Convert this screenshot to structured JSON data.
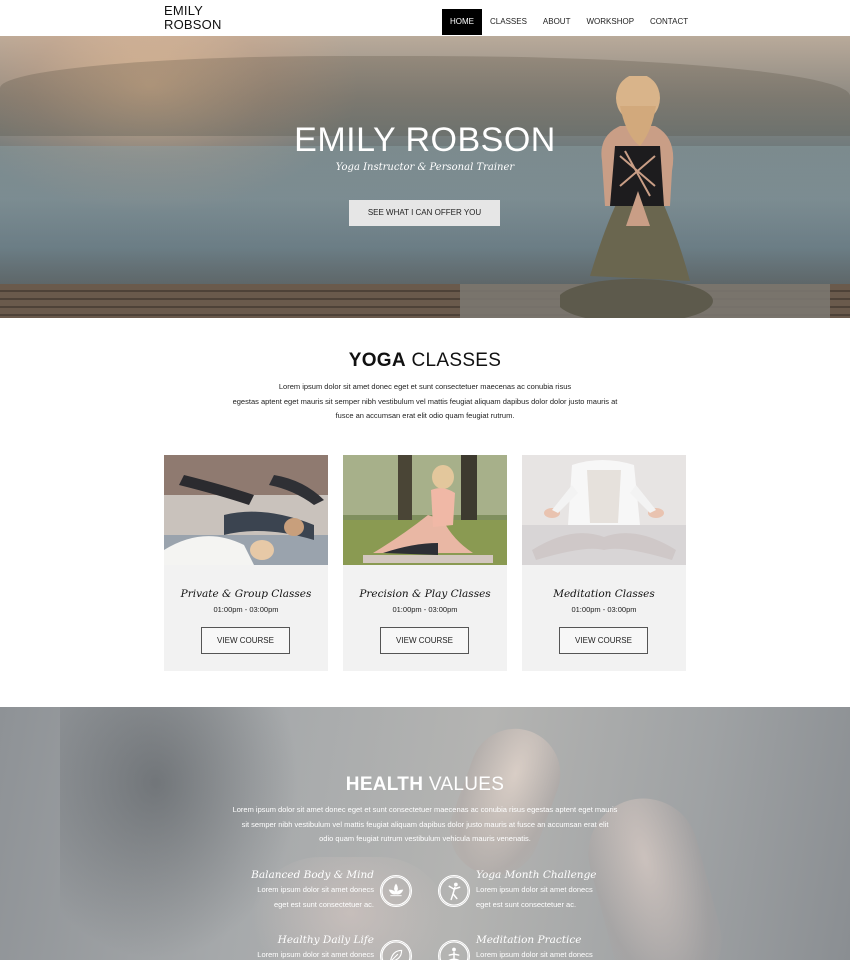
{
  "header": {
    "logo_line1": "EMILY",
    "logo_line2": "ROBSON",
    "nav": [
      "HOME",
      "CLASSES",
      "ABOUT",
      "WORKSHOP",
      "CONTACT"
    ]
  },
  "hero": {
    "title": "EMILY ROBSON",
    "subtitle": "Yoga Instructor & Personal Trainer",
    "cta": "SEE WHAT I CAN OFFER YOU"
  },
  "classes": {
    "title_bold": "YOGA",
    "title_rest": " CLASSES",
    "lorem_line1": "Lorem ipsum dolor sit amet donec eget et sunt consectetuer maecenas ac conubia risus",
    "lorem_line2": "egestas aptent eget mauris sit semper nibh vestibulum vel mattis feugiat aliquam dapibus dolor dolor justo mauris at",
    "lorem_line3": "fusce an accumsan erat elit odio quam feugiat rutrum.",
    "cards": [
      {
        "title": "Private & Group Classes",
        "time": "01:00pm - 03:00pm",
        "button": "VIEW COURSE"
      },
      {
        "title": "Precision & Play Classes",
        "time": "01:00pm - 03:00pm",
        "button": "VIEW COURSE"
      },
      {
        "title": "Meditation Classes",
        "time": "01:00pm - 03:00pm",
        "button": "VIEW COURSE"
      }
    ]
  },
  "health": {
    "title_bold": "HEALTH",
    "title_rest": " VALUES",
    "lorem_line1": "Lorem ipsum dolor sit amet donec eget et sunt consectetuer maecenas ac conubia risus egestas aptent eget mauris",
    "lorem_line2": "sit semper nibh vestibulum vel mattis feugiat aliquam dapibus dolor justo mauris at fusce an accumsan erat elit",
    "lorem_line3": "odio quam feugiat rutrum vestibulum vehicula mauris venenatis.",
    "features": [
      {
        "title": "Balanced Body & Mind",
        "line1": "Lorem ipsum dolor sit amet donecs",
        "line2": "eget est sunt consectetuer ac.",
        "icon": "lotus-icon"
      },
      {
        "title": "Yoga Month Challenge",
        "line1": "Lorem ipsum dolor sit amet donecs",
        "line2": "eget est sunt consectetuer ac.",
        "icon": "yoga-pose-icon"
      },
      {
        "title": "Healthy Daily Life",
        "line1": "Lorem ipsum dolor sit amet donecs",
        "line2": "",
        "icon": "leaf-icon"
      },
      {
        "title": "Meditation Practice",
        "line1": "Lorem ipsum dolor sit amet donecs",
        "line2": "",
        "icon": "meditation-icon"
      }
    ]
  }
}
